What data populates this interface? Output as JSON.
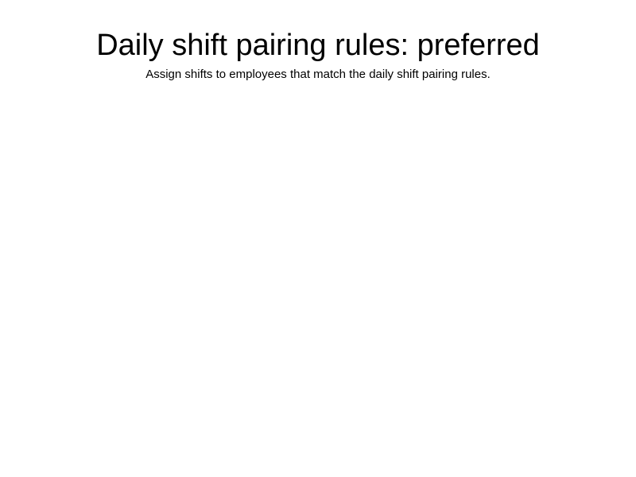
{
  "header": {
    "title": "Daily shift pairing rules: preferred",
    "subtitle": "Assign shifts to employees that match the daily shift pairing rules."
  }
}
